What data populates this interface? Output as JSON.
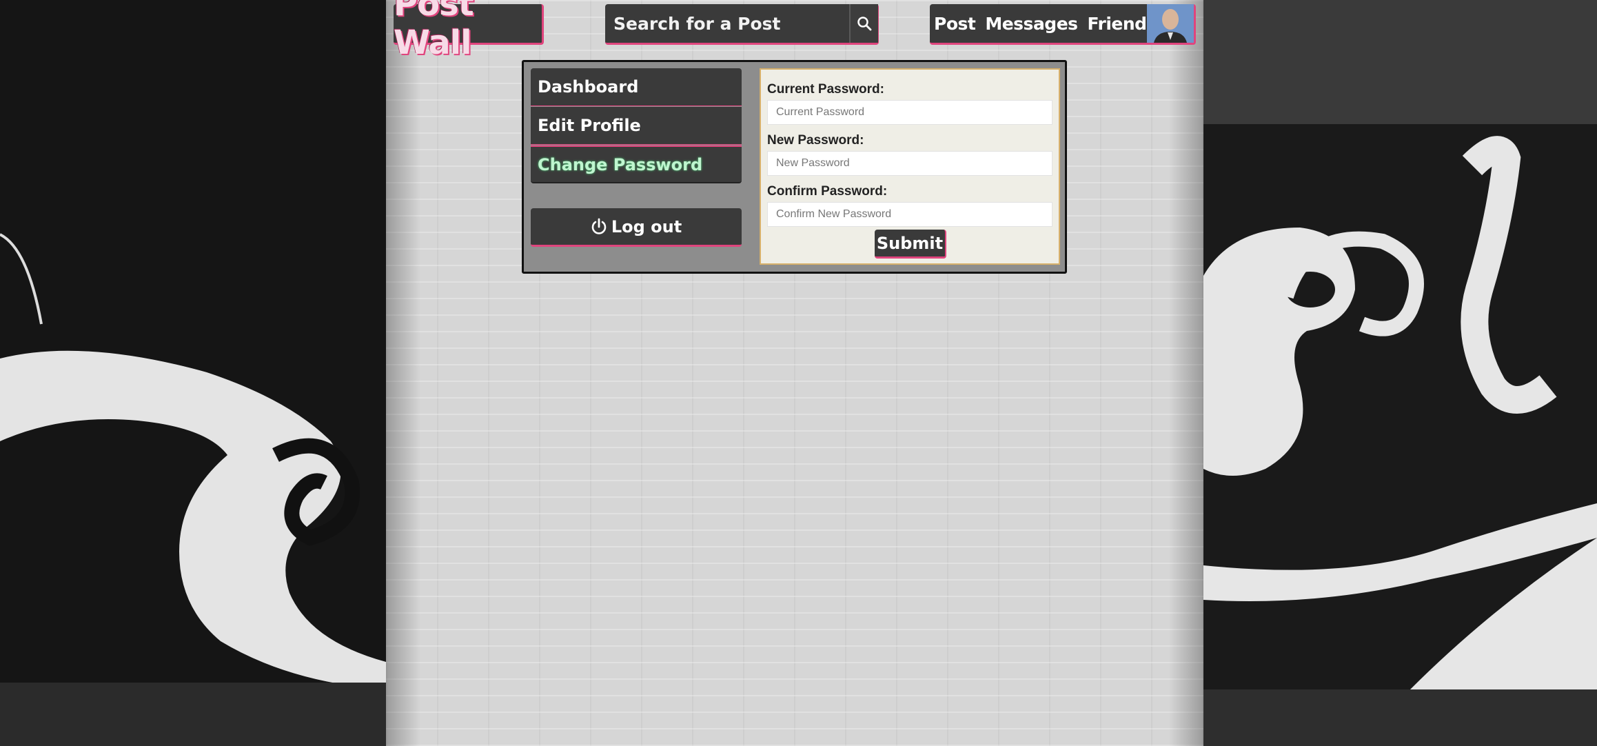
{
  "header": {
    "logo_text": "Post Wall",
    "search": {
      "placeholder": "Search for a Post"
    },
    "nav": [
      {
        "label": "Post"
      },
      {
        "label": "Messages"
      },
      {
        "label": "Friends"
      }
    ]
  },
  "sidebar": {
    "items": [
      {
        "label": "Dashboard"
      },
      {
        "label": "Edit Profile"
      },
      {
        "label": "Change Password"
      }
    ],
    "logout_label": "Log out"
  },
  "form": {
    "current": {
      "label": "Current Password:",
      "placeholder": "Current Password"
    },
    "new": {
      "label": "New Password:",
      "placeholder": "New Password"
    },
    "confirm": {
      "label": "Confirm Password:",
      "placeholder": "Confirm New Password"
    },
    "submit_label": "Submit"
  },
  "colors": {
    "accent": "#e0447d",
    "active_menu_text": "#bff5cf",
    "panel_dark": "#3a3a3a"
  },
  "icons": {
    "search": "search-icon",
    "logout": "power-icon"
  }
}
